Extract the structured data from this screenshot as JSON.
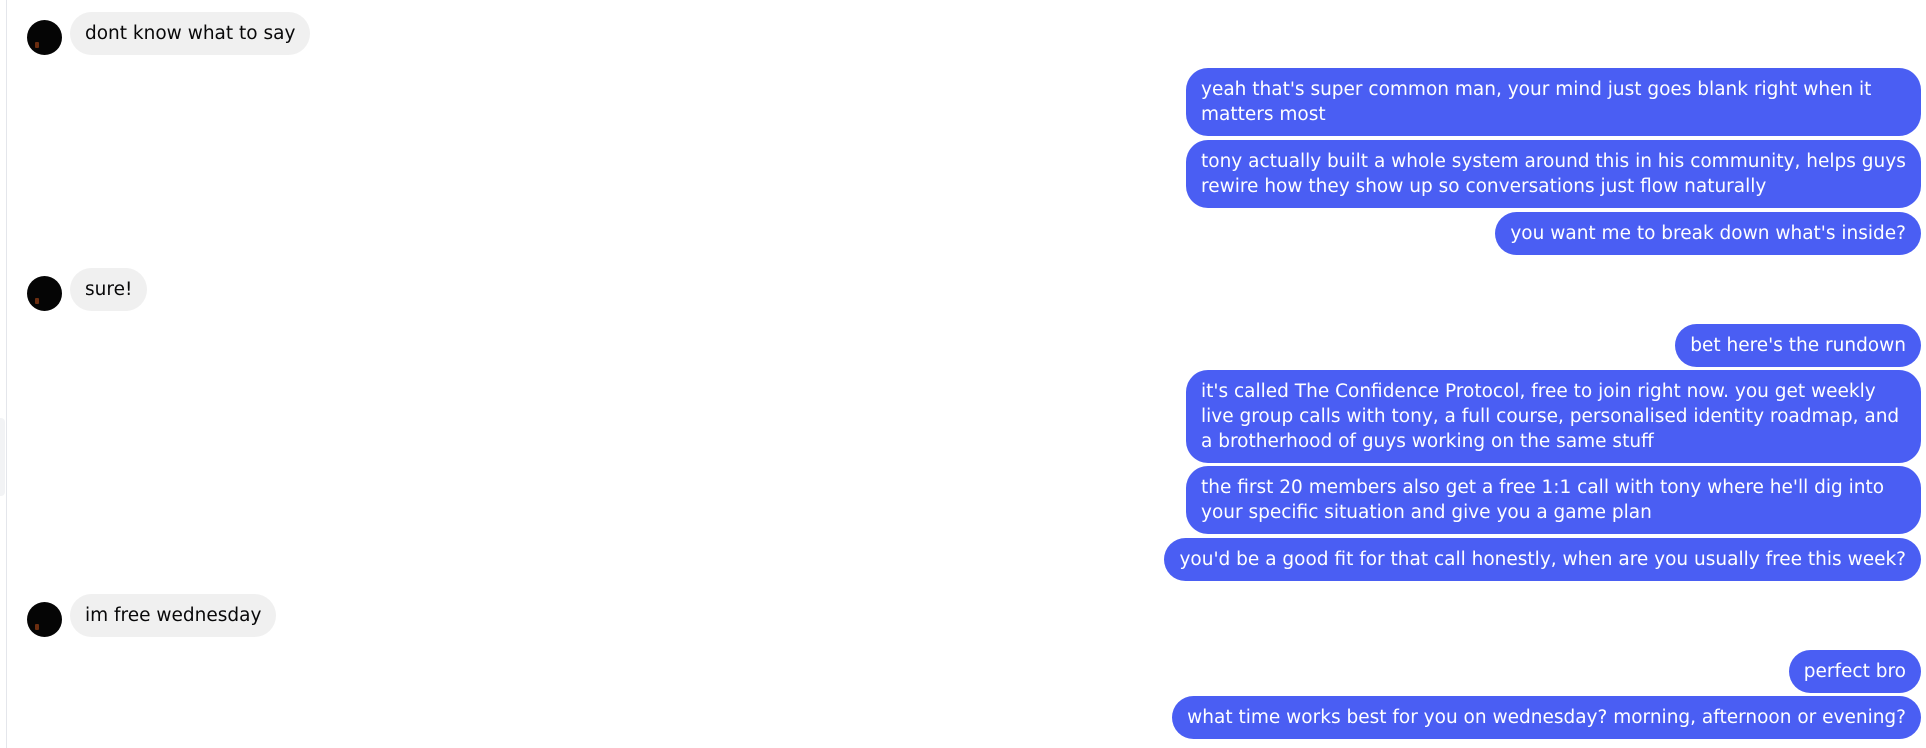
{
  "thread": {
    "messages": [
      {
        "side": "in",
        "text": "dont know what to say"
      },
      {
        "side": "out",
        "text": "yeah that's super common man, your mind just goes blank right when it matters most"
      },
      {
        "side": "out",
        "text": "tony actually built a whole system around this in his community, helps guys rewire how they show up so conversations just flow naturally"
      },
      {
        "side": "out",
        "text": "you want me to break down what's inside?"
      },
      {
        "side": "in",
        "text": "sure!"
      },
      {
        "side": "out",
        "text": "bet here's the rundown"
      },
      {
        "side": "out",
        "text": "it's called The Confidence Protocol, free to join right now. you get weekly live group calls with tony, a full course, personalised identity roadmap, and a brotherhood of guys working on the same stuff"
      },
      {
        "side": "out",
        "text": "the first 20 members also get a free 1:1 call with tony where he'll dig into your specific situation and give you a game plan"
      },
      {
        "side": "out",
        "text": "you'd be a good fit for that call honestly, when are you usually free this week?"
      },
      {
        "side": "in",
        "text": "im free wednesday"
      },
      {
        "side": "out",
        "text": "perfect bro"
      },
      {
        "side": "out",
        "text": "what time works best for you on wednesday? morning, afternoon or evening?"
      }
    ]
  },
  "colors": {
    "outgoing_bubble": "#4a5ef3",
    "incoming_bubble": "#f0f0f0",
    "avatar": "#050505"
  }
}
